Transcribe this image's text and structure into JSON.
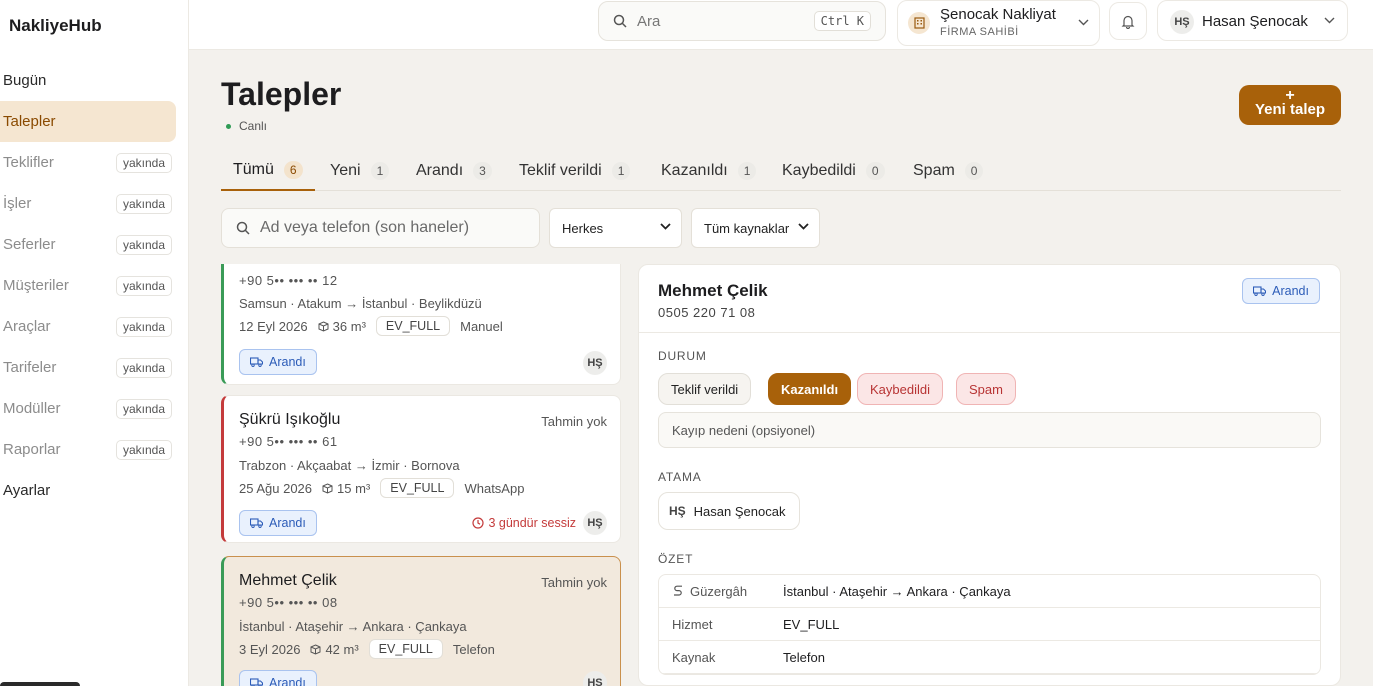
{
  "app": {
    "brand": "NakliyeHub"
  },
  "sidebar": {
    "items": [
      {
        "label": "Bugün",
        "soon": ""
      },
      {
        "label": "Talepler",
        "soon": ""
      },
      {
        "label": "Teklifler",
        "soon": "yakında"
      },
      {
        "label": "İşler",
        "soon": "yakında"
      },
      {
        "label": "Seferler",
        "soon": "yakında"
      },
      {
        "label": "Müşteriler",
        "soon": "yakında"
      },
      {
        "label": "Araçlar",
        "soon": "yakında"
      },
      {
        "label": "Tarifeler",
        "soon": "yakında"
      },
      {
        "label": "Modüller",
        "soon": "yakında"
      },
      {
        "label": "Raporlar",
        "soon": "yakında"
      },
      {
        "label": "Ayarlar",
        "soon": ""
      }
    ]
  },
  "topbar": {
    "search_placeholder": "Ara",
    "search_shortcut": "Ctrl K",
    "firm_name": "Şenocak Nakliyat",
    "firm_role": "FİRMA SAHİBİ",
    "user_initials": "HŞ",
    "user_name": "Hasan Şenocak"
  },
  "page": {
    "title": "Talepler",
    "live_label": "Canlı",
    "new_button_plus": "+",
    "new_button_label": "Yeni talep"
  },
  "tabs": [
    {
      "label": "Tümü",
      "count": "6"
    },
    {
      "label": "Yeni",
      "count": "1"
    },
    {
      "label": "Arandı",
      "count": "3"
    },
    {
      "label": "Teklif verildi",
      "count": "1"
    },
    {
      "label": "Kazanıldı",
      "count": "1"
    },
    {
      "label": "Kaybedildi",
      "count": "0"
    },
    {
      "label": "Spam",
      "count": "0"
    }
  ],
  "filters": {
    "search_placeholder": "Ad veya telefon (son haneler)",
    "assignee_selected": "Herkes",
    "source_selected": "Tüm kaynaklar"
  },
  "cards": [
    {
      "name": "",
      "estimate": "",
      "phone": "+90 5•• ••• •• 12",
      "route": "Samsun · Atakum → İstanbul · Beylikdüzü",
      "date": "12 Eyl 2026",
      "volume": "36 m³",
      "service": "EV_FULL",
      "source": "Manuel",
      "status": "Arandı",
      "silent": "",
      "initials": "HŞ"
    },
    {
      "name": "Şükrü Işıkoğlu",
      "estimate": "Tahmin yok",
      "phone": "+90 5•• ••• •• 61",
      "route": "Trabzon · Akçaabat → İzmir · Bornova",
      "date": "25 Ağu 2026",
      "volume": "15 m³",
      "service": "EV_FULL",
      "source": "WhatsApp",
      "status": "Arandı",
      "silent": "3 gündür sessiz",
      "initials": "HŞ"
    },
    {
      "name": "Mehmet Çelik",
      "estimate": "Tahmin yok",
      "phone": "+90 5•• ••• •• 08",
      "route": "İstanbul · Ataşehir → Ankara · Çankaya",
      "date": "3 Eyl 2026",
      "volume": "42 m³",
      "service": "EV_FULL",
      "source": "Telefon",
      "status": "Arandı",
      "silent": "",
      "initials": "HŞ"
    }
  ],
  "detail": {
    "name": "Mehmet Çelik",
    "phone": "0505 220 71 08",
    "status_badge": "Arandı",
    "status_section": "DURUM",
    "status_options": [
      "Teklif verildi",
      "Kazanıldı",
      "Kaybedildi",
      "Spam"
    ],
    "loss_reason_placeholder": "Kayıp nedeni (opsiyonel)",
    "assign_section": "ATAMA",
    "assignee_initials": "HŞ",
    "assignee_name": "Hasan Şenocak",
    "summary_section": "ÖZET",
    "summary": [
      {
        "key": "Güzergâh",
        "value": "İstanbul · Ataşehir → Ankara · Çankaya"
      },
      {
        "key": "Hizmet",
        "value": "EV_FULL"
      },
      {
        "key": "Kaynak",
        "value": "Telefon"
      }
    ]
  },
  "colors": {
    "accent": "#a8610a",
    "status_blue": "#2c5cb8",
    "danger": "#c43b3b",
    "success": "#3a9b57"
  }
}
